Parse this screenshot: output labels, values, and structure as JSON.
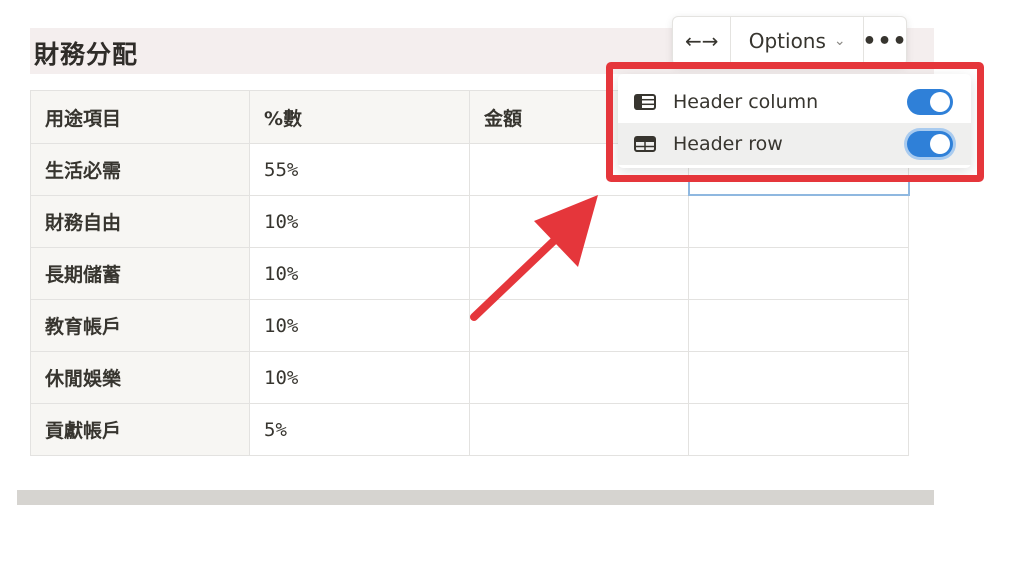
{
  "page": {
    "title": "財務分配"
  },
  "table": {
    "rows": [
      [
        "用途項目",
        "%數",
        "金額",
        ""
      ],
      [
        "生活必需",
        "55%",
        "",
        ""
      ],
      [
        "財務自由",
        "10%",
        "",
        ""
      ],
      [
        "長期儲蓄",
        "10%",
        "",
        ""
      ],
      [
        "教育帳戶",
        "10%",
        "",
        ""
      ],
      [
        "休閒娛樂",
        "10%",
        "",
        ""
      ],
      [
        "貢獻帳戶",
        "5%",
        "",
        ""
      ]
    ]
  },
  "toolbar": {
    "resize_glyph": "←→",
    "options_label": "Options",
    "options_chevron": "⌄",
    "more_glyph": "•••"
  },
  "menu": {
    "items": [
      {
        "label": "Header column",
        "icon": "header-column-icon",
        "enabled": true
      },
      {
        "label": "Header row",
        "icon": "header-row-icon",
        "enabled": true
      }
    ]
  },
  "colors": {
    "toggle_on": "#2f80d8",
    "highlight_frame": "#e5363b",
    "arrow": "#e5363b",
    "title_band": "#f4eeee"
  }
}
